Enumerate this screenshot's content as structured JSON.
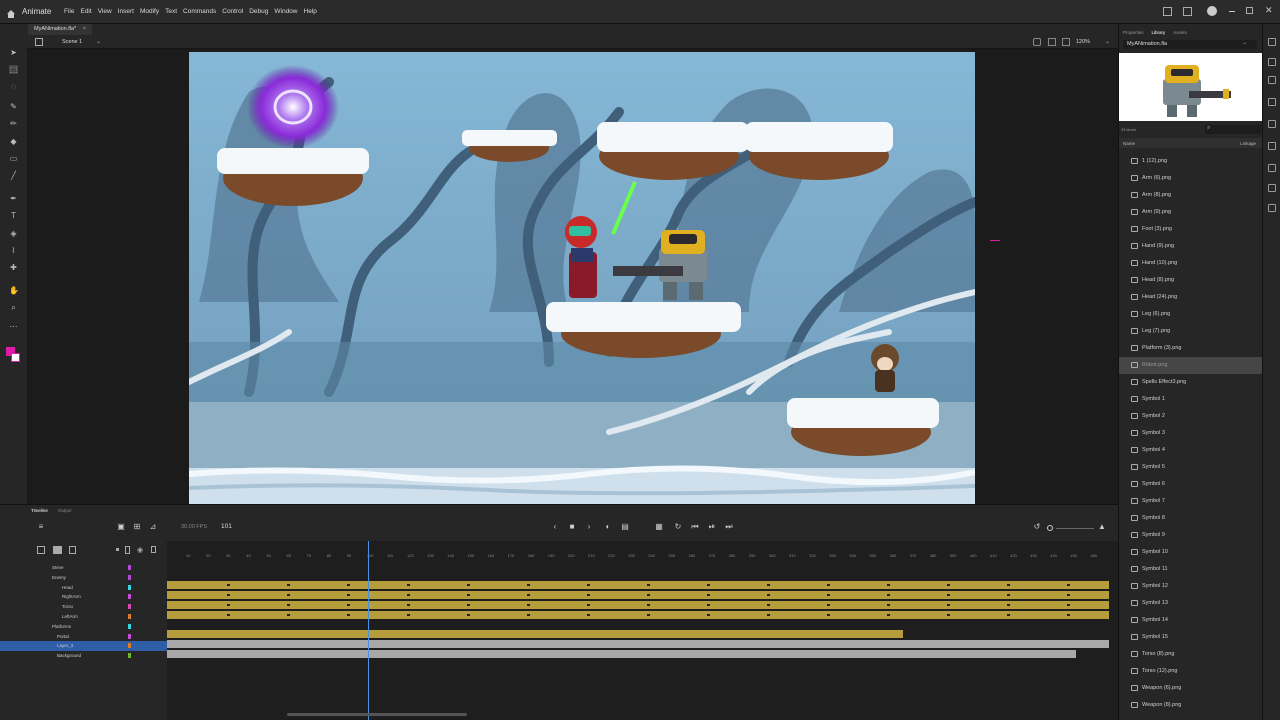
{
  "app": {
    "name": "Animate",
    "menus": [
      "File",
      "Edit",
      "View",
      "Insert",
      "Modify",
      "Text",
      "Commands",
      "Control",
      "Debug",
      "Window",
      "Help"
    ]
  },
  "document": {
    "tab": "MyANimation.fla*",
    "scene": "Scene 1",
    "zoom": "120%"
  },
  "library": {
    "tabs": [
      "Properties",
      "Library",
      "Assets"
    ],
    "active_tab": "Library",
    "file": "MyANimation.fla",
    "count": "33 items",
    "header_name": "Name",
    "header_linkage": "Linkage",
    "selected": "Robot.png",
    "items": [
      "1 (12).png",
      "Arm (6).png",
      "Arm (8).png",
      "Arm (9).png",
      "Foot (3).png",
      "Hand (9).png",
      "Hand (10).png",
      "Head (8).png",
      "Head (24).png",
      "Leg (6).png",
      "Leg (7).png",
      "Platform (3).png",
      "Robot.png",
      "Spells Effect3.png",
      "Symbol 1",
      "Symbol 2",
      "Symbol 3",
      "Symbol 4",
      "Symbol 5",
      "Symbol 6",
      "Symbol 7",
      "Symbol 8",
      "Symbol 9",
      "Symbol 10",
      "Symbol 11",
      "Symbol 12",
      "Symbol 13",
      "Symbol 14",
      "Symbol 15",
      "Torso (8).png",
      "Torso (12).png",
      "Weapon (6).png",
      "Weapon (8).png"
    ]
  },
  "timeline": {
    "tabs": [
      "Timeline",
      "Output"
    ],
    "active_tab": "Timeline",
    "fps": "30.00 FPS",
    "current_frame": "101",
    "ruler": [
      "10",
      "20",
      "30",
      "40",
      "50",
      "60",
      "70",
      "80",
      "90",
      "100",
      "110",
      "120",
      "130",
      "140",
      "150",
      "160",
      "170",
      "180",
      "190",
      "200",
      "210",
      "220",
      "230",
      "240",
      "250",
      "260",
      "270",
      "280",
      "290",
      "300",
      "310",
      "320",
      "330",
      "340",
      "350",
      "360",
      "370",
      "380",
      "390",
      "400",
      "410",
      "420",
      "430",
      "440",
      "450",
      "460"
    ],
    "layers": [
      {
        "name": "Steve",
        "indent": 0,
        "color": "#b04ad8"
      },
      {
        "name": "Enemy",
        "indent": 0,
        "color": "#b04ad8"
      },
      {
        "name": "Head",
        "indent": 2,
        "color": "#36d8e0"
      },
      {
        "name": "RightArm",
        "indent": 2,
        "color": "#c84ad8"
      },
      {
        "name": "Torso",
        "indent": 2,
        "color": "#d84ab8"
      },
      {
        "name": "LeftArm",
        "indent": 2,
        "color": "#e07a2a"
      },
      {
        "name": "Platforms",
        "indent": 0,
        "color": "#36d8e0"
      },
      {
        "name": "Portal",
        "indent": 1,
        "color": "#c84ad8"
      },
      {
        "name": "Layer_3",
        "indent": 1,
        "color": "#e07a2a"
      },
      {
        "name": "Background",
        "indent": 1,
        "color": "#6ab82a"
      }
    ],
    "selected_layer": "Layer_3"
  }
}
